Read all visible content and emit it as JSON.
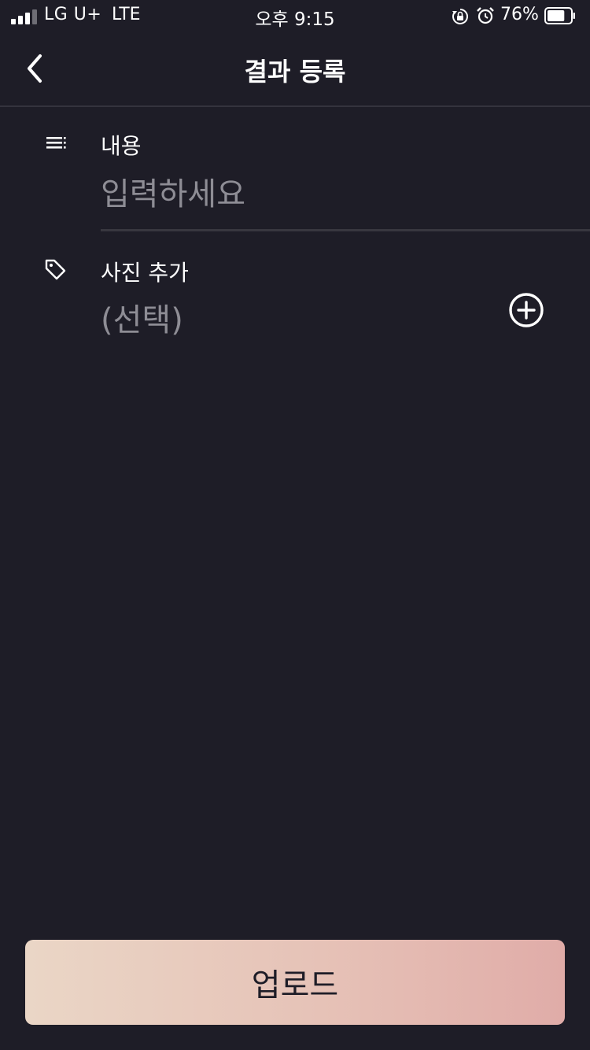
{
  "status_bar": {
    "carrier": "LG U+",
    "network": "LTE",
    "time": "오후 9:15",
    "battery_percent": "76%",
    "battery_level": 0.76,
    "signal_bars": 4,
    "signal_bars_filled": 3
  },
  "nav": {
    "title": "결과 등록",
    "back_icon": "chevron-left-icon"
  },
  "form": {
    "content": {
      "icon": "text-lines-icon",
      "label": "내용",
      "placeholder": "입력하세요"
    },
    "photo": {
      "icon": "tag-icon",
      "label": "사진 추가",
      "value": "(선택)",
      "add_icon": "plus-circle-icon"
    }
  },
  "upload_button": {
    "label": "업로드"
  },
  "colors": {
    "background": "#1e1d27",
    "divider": "#38373f",
    "placeholder": "#8e8d95",
    "button_gradient_start": "#ead6c6",
    "button_gradient_end": "#e0aca8"
  }
}
